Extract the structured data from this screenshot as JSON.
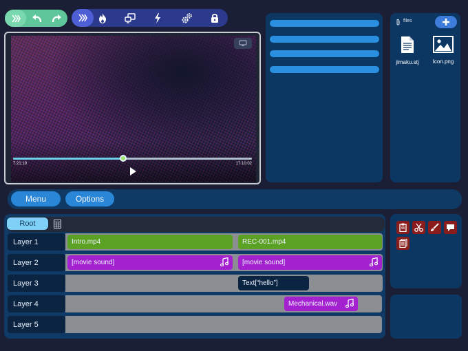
{
  "toolbar": {
    "primary_icons": [
      "chevrons-right-icon",
      "undo-icon",
      "redo-icon"
    ],
    "secondary_icons": [
      "chevrons-right-icon",
      "flame-icon",
      "share-screen-icon",
      "lightning-icon",
      "settings-icon",
      "lock-icon"
    ]
  },
  "player": {
    "current_time": "7:21:19",
    "total_time": "17:10:02",
    "progress": 0.46
  },
  "list_panel": {
    "item_count": 4
  },
  "files": {
    "label": "files",
    "items": [
      {
        "name": "jimaku.stj",
        "icon": "document-icon"
      },
      {
        "name": "Icon.png",
        "icon": "image-icon"
      }
    ]
  },
  "menu": {
    "menu_label": "Menu",
    "options_label": "Options"
  },
  "timeline": {
    "root_tab": "Root",
    "layers": [
      {
        "label": "Layer 1"
      },
      {
        "label": "Layer 2"
      },
      {
        "label": "Layer 3"
      },
      {
        "label": "Layer 4"
      },
      {
        "label": "Layer 5"
      }
    ],
    "clips": {
      "intro": "Intro.mp4",
      "rec": "REC-001.mp4",
      "sound1": "[movie sound]",
      "sound2": "[movie sound]",
      "text": "Text[“hello”]",
      "mech": "Mechanical.wav"
    }
  },
  "tools": [
    "clipboard-icon",
    "scissors-icon",
    "brush-icon",
    "comment-icon",
    "paste-document-icon"
  ],
  "colors": {
    "background": "#1b1f35",
    "panel": "#0d3763",
    "accent_green": "#5ec69a",
    "accent_blue": "#2b3a8c",
    "video_clip": "#5ba124",
    "audio_clip": "#a321cf",
    "tool_red": "#8a1c1c"
  }
}
